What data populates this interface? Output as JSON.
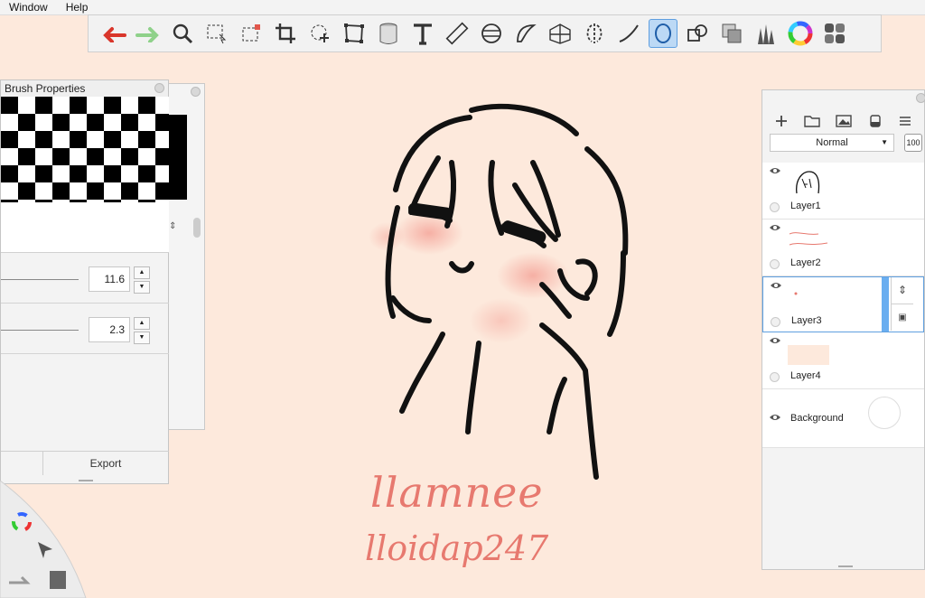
{
  "menu": {
    "items": [
      "Window",
      "Help"
    ]
  },
  "toolbar": {
    "tools": [
      "undo-icon",
      "redo-icon",
      "zoom-icon",
      "select-icon",
      "magic-select-icon",
      "crop-icon",
      "transform-icon",
      "distort-icon",
      "fill-icon",
      "text-icon",
      "ruler-icon",
      "ellipse-guide-icon",
      "curve-guide-icon",
      "perspective-icon",
      "symmetry-icon",
      "stroke-icon",
      "lasso-icon",
      "shapes-icon",
      "layers-icon",
      "brush-library-icon",
      "color-wheel-icon",
      "copic-icon"
    ]
  },
  "brush_panel": {
    "title": "Brush Properties",
    "size_value": "11.6",
    "opacity_value": "2.3",
    "export_label": "Export"
  },
  "layers_panel": {
    "blend_mode": "Normal",
    "opacity": "100",
    "layers": [
      {
        "name": "Layer1"
      },
      {
        "name": "Layer2"
      },
      {
        "name": "Layer3"
      },
      {
        "name": "Layer4"
      },
      {
        "name": "Background"
      }
    ]
  },
  "canvas": {
    "signature_line1": "llamnee",
    "signature_line2": "lloidap247"
  },
  "colors": {
    "canvas_bg": "#fde9dc",
    "accent": "#5f9fe0",
    "ink": "#111111",
    "signature": "#e7796f"
  }
}
